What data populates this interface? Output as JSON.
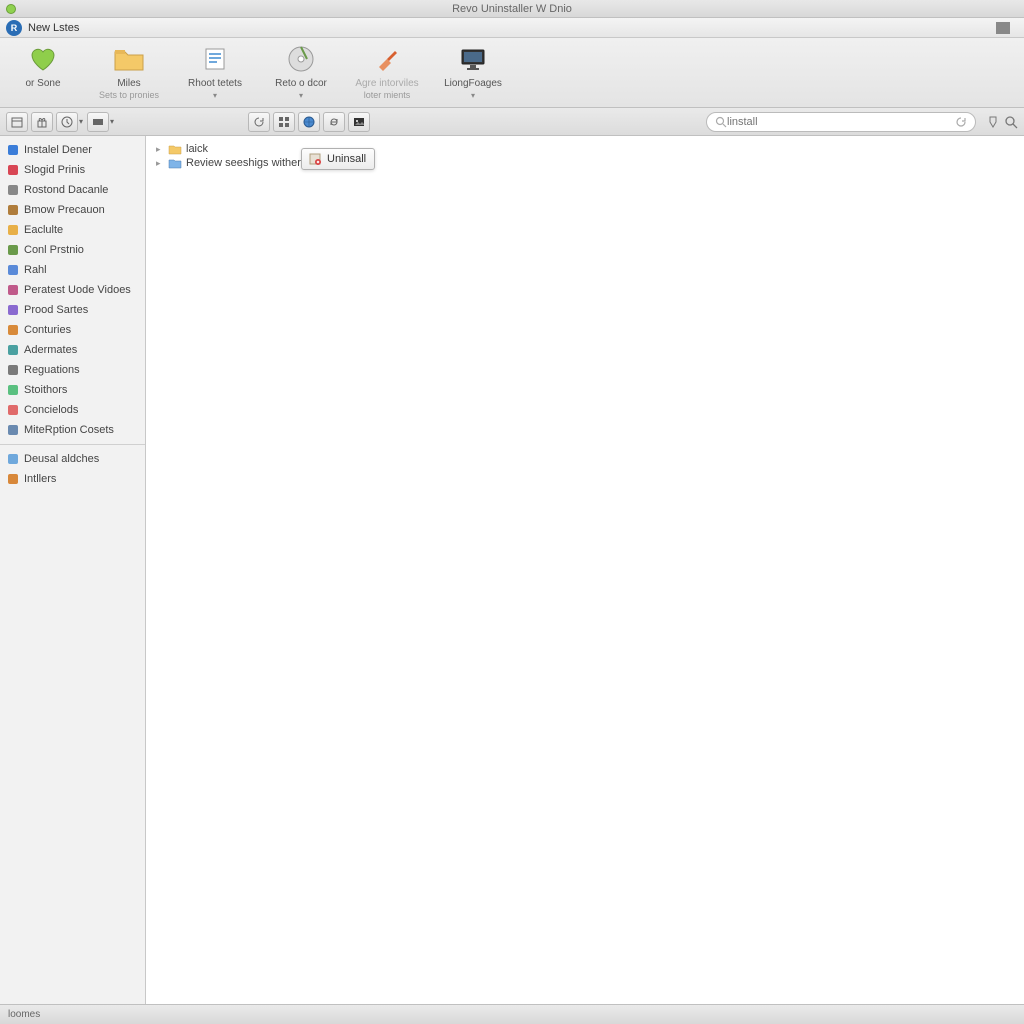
{
  "window": {
    "title": "Revo Uninstaller W Dnio"
  },
  "menubar": {
    "label": "New Lstes"
  },
  "toolbar": {
    "items": [
      {
        "label": "or Sone",
        "sub": "",
        "icon": "heart",
        "color": "#8fce4b"
      },
      {
        "label": "Miles",
        "sub": "Sets to pronies",
        "icon": "folder",
        "color": "#f4c968"
      },
      {
        "label": "Rhoot tetets",
        "sub": "",
        "icon": "doc",
        "color": "#6fa8dc",
        "drop": true
      },
      {
        "label": "Reto o dcor",
        "sub": "",
        "icon": "disc",
        "color": "#a0a0a0",
        "drop": true
      },
      {
        "label": "Agre intorviles",
        "sub": "loter mients",
        "icon": "brush",
        "color": "#e89060",
        "disabled": true
      },
      {
        "label": "LiongFoages",
        "sub": "",
        "icon": "monitor",
        "color": "#555",
        "drop": true
      }
    ]
  },
  "secondbar": {
    "left_icons": [
      "calendar",
      "gift",
      "clock",
      "view"
    ],
    "mid_icons": [
      "refresh",
      "grid",
      "globe",
      "sync",
      "image"
    ]
  },
  "search": {
    "placeholder": "linstall"
  },
  "sidebar": {
    "items": [
      {
        "label": "Instalel Dener",
        "icon": "app",
        "color": "#3b7dd8"
      },
      {
        "label": "Slogid Prinis",
        "icon": "pin",
        "color": "#d84654"
      },
      {
        "label": "Rostond Dacanle",
        "icon": "disc",
        "color": "#888"
      },
      {
        "label": "Bmow Precauon",
        "icon": "shield",
        "color": "#b07d3c"
      },
      {
        "label": "Eaclulte",
        "icon": "star",
        "color": "#e8b048"
      },
      {
        "label": "Conl Prstnio",
        "icon": "gear",
        "color": "#6a9a4a"
      },
      {
        "label": "Rahl",
        "icon": "flag",
        "color": "#5a8ad8"
      },
      {
        "label": "Peratest Uode Vidoes",
        "icon": "video",
        "color": "#c05a8a"
      },
      {
        "label": "Prood Sartes",
        "icon": "box",
        "color": "#8a6ad0"
      },
      {
        "label": "Conturies",
        "icon": "tool",
        "color": "#d88a3a"
      },
      {
        "label": "Adermates",
        "icon": "puzzle",
        "color": "#4aa0a0"
      },
      {
        "label": "Reguations",
        "icon": "book",
        "color": "#7a7a7a"
      },
      {
        "label": "Stoithors",
        "icon": "key",
        "color": "#5ac080"
      },
      {
        "label": "Concielods",
        "icon": "cloud",
        "color": "#e06a6a"
      },
      {
        "label": "MiteRption Cosets",
        "icon": "list",
        "color": "#6a8ab0"
      }
    ],
    "items2": [
      {
        "label": "Deusal aldches",
        "icon": "folder",
        "color": "#6fa8dc"
      },
      {
        "label": "Intllers",
        "icon": "pkg",
        "color": "#d8883a"
      }
    ]
  },
  "tree": {
    "rows": [
      {
        "label": "laick",
        "icon": "folder"
      },
      {
        "label": "Review seeshigs witherl",
        "icon": "bluefolder",
        "badge": true
      }
    ]
  },
  "tooltip": {
    "label": "Uninsall"
  },
  "statusbar": {
    "text": "loomes"
  }
}
